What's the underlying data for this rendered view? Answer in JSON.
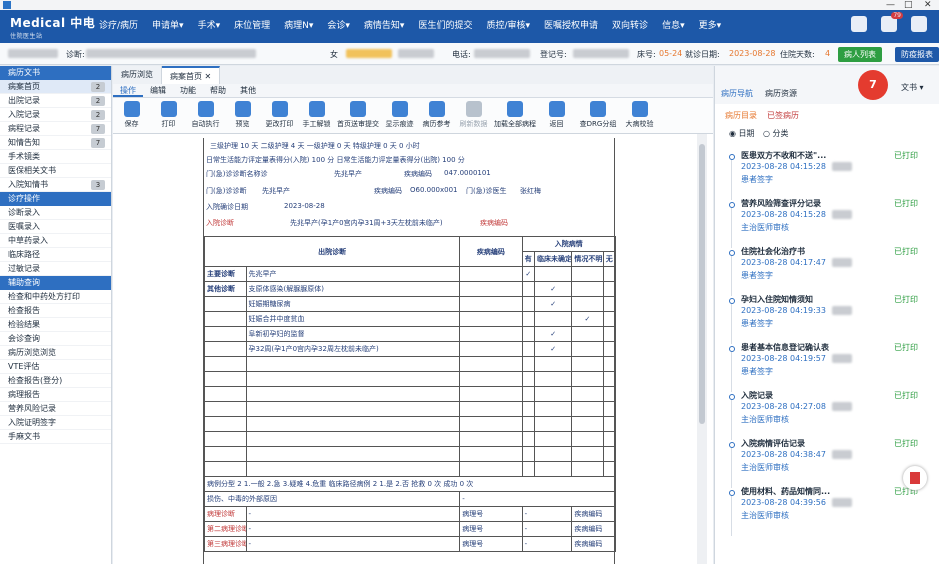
{
  "window": {
    "app_label": "",
    "controls": [
      "—",
      "□",
      "✕"
    ]
  },
  "top_nav": {
    "logo": "Medical 中电",
    "logo_sub": "住院医生站",
    "menu": [
      "诊疗/病历",
      "申请单▾",
      "手术▾",
      "床位管理",
      "病理N▾",
      "会诊▾",
      "病情告知▾",
      "医生们的提交",
      "质控/审核▾",
      "医嘱授权申请",
      "双向转诊",
      "信息▾",
      "更多▾"
    ],
    "badge": "79"
  },
  "patient_bar": {
    "diagnosis_label": "诊断:",
    "sex": "女",
    "phone_label": "电话:",
    "reg_label": "登记号:",
    "bed_label": "床号:",
    "bed": "05-24",
    "admit_label": "就诊日期:",
    "admit_date": "2023-08-28",
    "days_label": "住院天数:",
    "days": "4",
    "btn_release": "病人列表",
    "btn_report": "防疫报表"
  },
  "sidebar": {
    "sections": [
      {
        "title": "病历文书",
        "items": [
          {
            "label": "病案首页",
            "count": "2",
            "active": true
          },
          {
            "label": "出院记录",
            "count": "2"
          },
          {
            "label": "入院记录",
            "count": "2"
          },
          {
            "label": "病程记录",
            "count": "7"
          },
          {
            "label": "知情告知",
            "count": "7"
          },
          {
            "label": "手术镜类",
            "count": ""
          },
          {
            "label": "医保相关文书",
            "count": ""
          },
          {
            "label": "入院知情书",
            "count": "3"
          }
        ]
      },
      {
        "title": "诊疗操作",
        "items": [
          {
            "label": "诊断录入"
          },
          {
            "label": "医嘱录入"
          },
          {
            "label": "中草药录入"
          },
          {
            "label": "临床路径"
          },
          {
            "label": "过敏记录"
          }
        ]
      },
      {
        "title": "辅助查询",
        "items": [
          {
            "label": "检查和中药处方打印"
          },
          {
            "label": "检查报告"
          },
          {
            "label": "检验结果"
          },
          {
            "label": "会诊查询"
          },
          {
            "label": "病历浏览浏览"
          },
          {
            "label": "VTE评估"
          },
          {
            "label": "检查报告(登分)"
          },
          {
            "label": "病理报告"
          },
          {
            "label": "营养风险记录"
          },
          {
            "label": "入院证明签字"
          },
          {
            "label": "手麻文书"
          }
        ]
      }
    ]
  },
  "tabs": [
    "病历浏览",
    "病案首页"
  ],
  "subtabs": [
    "操作",
    "编辑",
    "功能",
    "帮助",
    "其他"
  ],
  "toolbar": [
    {
      "label": "保存",
      "dim": false
    },
    {
      "label": "打印",
      "dim": false
    },
    {
      "label": "自动执行",
      "dim": false
    },
    {
      "label": "预览",
      "dim": false
    },
    {
      "label": "更改打印",
      "dim": false
    },
    {
      "label": "手工解锁",
      "dim": false
    },
    {
      "label": "首页送审提交",
      "dim": false
    },
    {
      "label": "显示痕迹",
      "dim": false
    },
    {
      "label": "病历参考",
      "dim": false
    },
    {
      "label": "刷新数据",
      "dim": true
    },
    {
      "label": "加载全部病程",
      "dim": false
    },
    {
      "label": "返回",
      "dim": false
    },
    {
      "label": "查DRG分组",
      "dim": false
    },
    {
      "label": "大病校验",
      "dim": false
    }
  ],
  "document": {
    "row1": "三级护理  10  天    二级护理  4  天    一级护理  0  天    特级护理  0  天    0  小时",
    "row2": "日常生活能力评定量表得分(入院)  100  分      日常生活能力评定量表得分(出院)  100  分",
    "row3_label": "门(急)诊诊断名称诊",
    "row3_val": "先兆早产",
    "row3_code_label": "疾病编码",
    "row3_code": "047.0000101",
    "row4_label": "门(急)诊诊断",
    "row4_val": "先兆早产",
    "row4_code_label": "疾病编码",
    "row4_code": "O60.000x001",
    "row4_doc_label": "门(急)诊医生",
    "row4_doc": "张红梅",
    "row5_label": "入院确诊日期",
    "row5_val": "2023-08-28",
    "row6_label": "入院诊断",
    "row6_val": "先兆早产(孕1产0宫内孕31周+3天左枕前未临产)",
    "row6_code_label": "疾病编码",
    "table_headers": [
      "出院诊断",
      "疾病编码",
      "入院病情"
    ],
    "sub_headers": [
      "有",
      "临床未确定",
      "情况不明",
      "无"
    ],
    "rows": [
      {
        "label": "主要诊断",
        "dx": "先兆早产",
        "checks": [
          1,
          0,
          0,
          0
        ]
      },
      {
        "label": "其他诊断",
        "dx": "支原体感染(解脲脲原体)",
        "checks": [
          0,
          1,
          0,
          0
        ]
      },
      {
        "label": "",
        "dx": "妊娠期糖尿病",
        "checks": [
          0,
          1,
          0,
          0
        ]
      },
      {
        "label": "",
        "dx": "妊娠合并中度贫血",
        "checks": [
          0,
          0,
          1,
          0
        ]
      },
      {
        "label": "",
        "dx": "阜新初孕妇的监督",
        "checks": [
          0,
          1,
          0,
          0
        ]
      },
      {
        "label": "",
        "dx": "孕32周(孕1产0宫内孕32周左枕前未临产)",
        "checks": [
          0,
          1,
          0,
          0
        ]
      }
    ],
    "footer1": "病例分型  2  1.一般 2.急 3.疑难 4.危重      临床路径病例  2  1.是 2.否    抢救  0  次    成功  0  次",
    "footer2_a": "损伤、中毒的外部原因",
    "footer2_b": "-",
    "footer3": [
      "病理诊断",
      "-",
      "病理号",
      "-",
      "疾病编码"
    ],
    "footer4": [
      "第二病理诊断",
      "-",
      "病理号",
      "-",
      "疾病编码"
    ],
    "footer5": [
      "第三病理诊断",
      "-",
      "病理号",
      "-",
      "疾病编码"
    ]
  },
  "right_panel": {
    "tabs": [
      "病历导航",
      "病历资源"
    ],
    "bubble": "7",
    "bubble_side": "文书 ▾",
    "subs": [
      "病历目录",
      "已签病历"
    ],
    "radios": [
      "日期",
      "分类"
    ],
    "records": [
      {
        "title": "医患双方不收和不送\"...",
        "date": "2023-08-28  04:15:28",
        "sign": "患者签字",
        "status": "已打印"
      },
      {
        "title": "营养风险筛查评分记录",
        "date": "2023-08-28  04:15:28",
        "sign": "主治医师审核",
        "status": "已打印"
      },
      {
        "title": "住院社会化治疗书",
        "date": "2023-08-28  04:17:47",
        "sign": "患者签字",
        "status": "已打印"
      },
      {
        "title": "孕妇入住院知情须知",
        "date": "2023-08-28  04:19:33",
        "sign": "患者签字",
        "status": "已打印"
      },
      {
        "title": "患者基本信息登记确认表",
        "date": "2023-08-28  04:19:57",
        "sign": "患者签字",
        "status": "已打印"
      },
      {
        "title": "入院记录",
        "date": "2023-08-28  04:27:08",
        "sign": "主治医师审核",
        "status": "已打印"
      },
      {
        "title": "入院病情评估记录",
        "date": "2023-08-28  04:38:47",
        "sign": "主治医师审核",
        "status": "已打印"
      },
      {
        "title": "使用材料、药品知情同...",
        "date": "2023-08-28  04:39:56",
        "sign": "主治医师审核",
        "status": "已打印"
      }
    ]
  },
  "colors": {
    "nav": "#1d58a8",
    "accent": "#2e6fc1",
    "ok": "#2e9e42",
    "alert": "#e43b2f"
  }
}
